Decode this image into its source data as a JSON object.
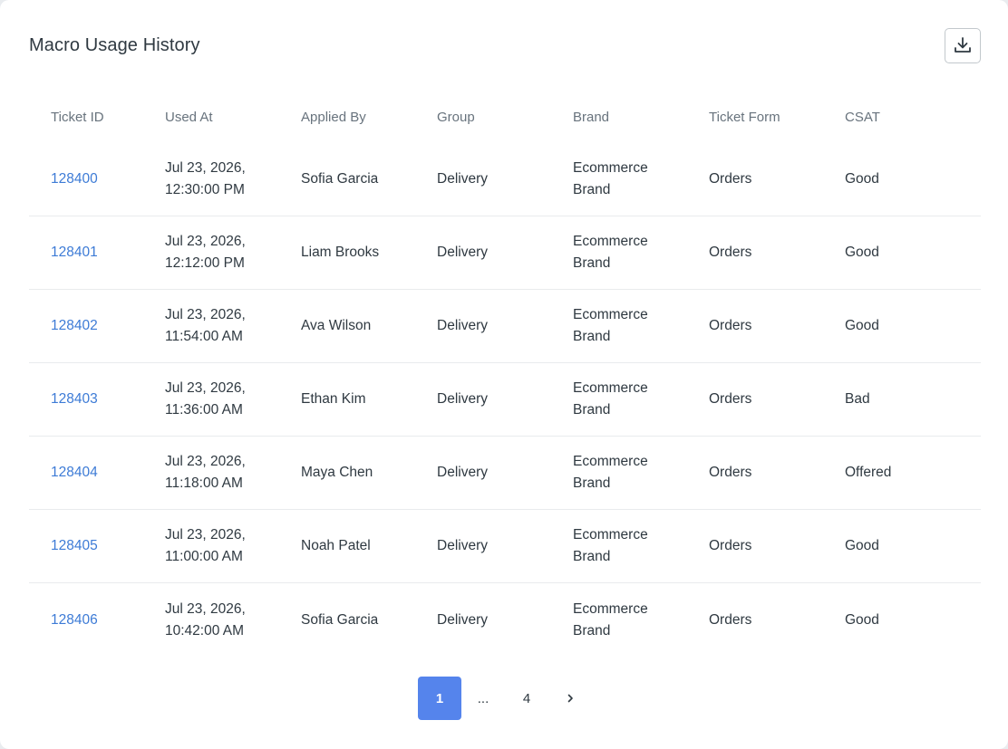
{
  "header": {
    "title": "Macro Usage History",
    "download_icon": "download-icon"
  },
  "table": {
    "columns": [
      "Ticket ID",
      "Used At",
      "Applied By",
      "Group",
      "Brand",
      "Ticket Form",
      "CSAT"
    ],
    "rows": [
      {
        "ticket_id": "128400",
        "used_at_date": "Jul 23, 2026,",
        "used_at_time": "12:30:00 PM",
        "applied_by": "Sofia Garcia",
        "group": "Delivery",
        "brand_line1": "Ecommerce",
        "brand_line2": "Brand",
        "ticket_form": "Orders",
        "csat": "Good"
      },
      {
        "ticket_id": "128401",
        "used_at_date": "Jul 23, 2026,",
        "used_at_time": "12:12:00 PM",
        "applied_by": "Liam Brooks",
        "group": "Delivery",
        "brand_line1": "Ecommerce",
        "brand_line2": "Brand",
        "ticket_form": "Orders",
        "csat": "Good"
      },
      {
        "ticket_id": "128402",
        "used_at_date": "Jul 23, 2026,",
        "used_at_time": "11:54:00 AM",
        "applied_by": "Ava Wilson",
        "group": "Delivery",
        "brand_line1": "Ecommerce",
        "brand_line2": "Brand",
        "ticket_form": "Orders",
        "csat": "Good"
      },
      {
        "ticket_id": "128403",
        "used_at_date": "Jul 23, 2026,",
        "used_at_time": "11:36:00 AM",
        "applied_by": "Ethan Kim",
        "group": "Delivery",
        "brand_line1": "Ecommerce",
        "brand_line2": "Brand",
        "ticket_form": "Orders",
        "csat": "Bad"
      },
      {
        "ticket_id": "128404",
        "used_at_date": "Jul 23, 2026,",
        "used_at_time": "11:18:00 AM",
        "applied_by": "Maya Chen",
        "group": "Delivery",
        "brand_line1": "Ecommerce",
        "brand_line2": "Brand",
        "ticket_form": "Orders",
        "csat": "Offered"
      },
      {
        "ticket_id": "128405",
        "used_at_date": "Jul 23, 2026,",
        "used_at_time": "11:00:00 AM",
        "applied_by": "Noah Patel",
        "group": "Delivery",
        "brand_line1": "Ecommerce",
        "brand_line2": "Brand",
        "ticket_form": "Orders",
        "csat": "Good"
      },
      {
        "ticket_id": "128406",
        "used_at_date": "Jul 23, 2026,",
        "used_at_time": "10:42:00 AM",
        "applied_by": "Sofia Garcia",
        "group": "Delivery",
        "brand_line1": "Ecommerce",
        "brand_line2": "Brand",
        "ticket_form": "Orders",
        "csat": "Good"
      }
    ]
  },
  "pagination": {
    "current": "1",
    "gap": "...",
    "last": "4",
    "next_icon": "chevron-right-icon"
  },
  "colors": {
    "link": "#3d7bd6",
    "active_page": "#5584ec",
    "header_text": "#68737d"
  }
}
